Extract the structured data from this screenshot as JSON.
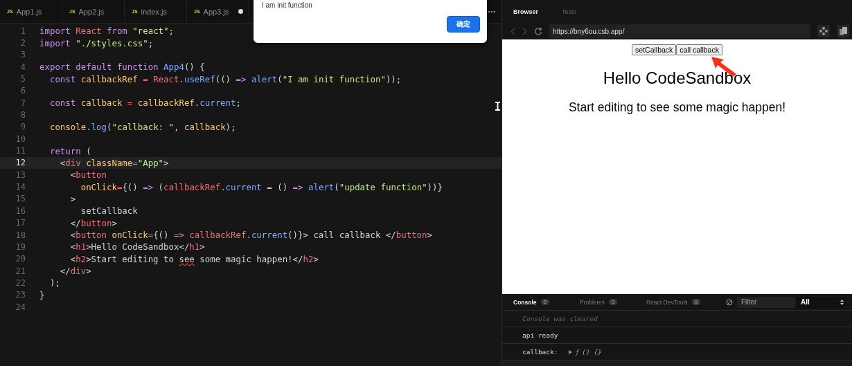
{
  "editor": {
    "tabs": [
      {
        "label": "App1.js",
        "badge": "JS",
        "modified": false,
        "selected": false
      },
      {
        "label": "App2.js",
        "badge": "JS",
        "modified": false,
        "selected": false
      },
      {
        "label": "index.js",
        "badge": "JS",
        "modified": false,
        "selected": false
      },
      {
        "label": "App3.js",
        "badge": "JS",
        "modified": true,
        "selected": false
      }
    ],
    "more": "•••",
    "lines": [
      {
        "number": "1",
        "current": false,
        "tokens": [
          {
            "kind": "kw",
            "text": "import "
          },
          {
            "kind": "name",
            "text": "React "
          },
          {
            "kind": "kw",
            "text": "from "
          },
          {
            "kind": "str",
            "text": "\"react\""
          },
          {
            "kind": "p",
            "text": ";"
          }
        ]
      },
      {
        "number": "2",
        "current": false,
        "tokens": [
          {
            "kind": "kw",
            "text": "import "
          },
          {
            "kind": "str",
            "text": "\"./styles.css\""
          },
          {
            "kind": "p",
            "text": ";"
          }
        ]
      },
      {
        "number": "3",
        "current": false
      },
      {
        "number": "4",
        "current": false,
        "tokens": [
          {
            "kind": "kw",
            "text": "export default function "
          },
          {
            "kind": "fn",
            "text": "App4"
          },
          {
            "kind": "p",
            "text": "() {"
          }
        ]
      },
      {
        "number": "5",
        "current": false,
        "tokens": [
          {
            "kind": "kw",
            "text": "  const "
          },
          {
            "kind": "var",
            "text": "callbackRef "
          },
          {
            "kind": "op",
            "text": "= "
          },
          {
            "kind": "name",
            "text": "React"
          },
          {
            "kind": "p",
            "text": "."
          },
          {
            "kind": "fn",
            "text": "useRef"
          },
          {
            "kind": "p",
            "text": "(() "
          },
          {
            "kind": "kw",
            "text": "=> "
          },
          {
            "kind": "fn",
            "text": "alert"
          },
          {
            "kind": "p",
            "text": "("
          },
          {
            "kind": "str",
            "text": "\"I am init function\""
          },
          {
            "kind": "p",
            "text": "));"
          }
        ]
      },
      {
        "number": "6",
        "current": false
      },
      {
        "number": "7",
        "current": false,
        "tokens": [
          {
            "kind": "kw",
            "text": "  const "
          },
          {
            "kind": "var",
            "text": "callback "
          },
          {
            "kind": "op",
            "text": "= "
          },
          {
            "kind": "var",
            "text": "callbackRef"
          },
          {
            "kind": "p",
            "text": "."
          },
          {
            "kind": "fn",
            "text": "current"
          },
          {
            "kind": "p",
            "text": ";"
          }
        ]
      },
      {
        "number": "8",
        "current": false
      },
      {
        "number": "9",
        "current": false,
        "tokens": [
          {
            "kind": "var",
            "text": "  console"
          },
          {
            "kind": "p",
            "text": "."
          },
          {
            "kind": "fn",
            "text": "log"
          },
          {
            "kind": "p",
            "text": "("
          },
          {
            "kind": "str",
            "text": "\"callback: \""
          },
          {
            "kind": "p",
            "text": ", "
          },
          {
            "kind": "var",
            "text": "callback"
          },
          {
            "kind": "p",
            "text": ");"
          }
        ]
      },
      {
        "number": "10",
        "current": false
      },
      {
        "number": "11",
        "current": false,
        "tokens": [
          {
            "kind": "kw",
            "text": "  return "
          },
          {
            "kind": "p",
            "text": "("
          }
        ]
      },
      {
        "number": "12",
        "current": true,
        "tokens": [
          {
            "kind": "p",
            "text": "    <"
          },
          {
            "kind": "tag",
            "text": "div "
          },
          {
            "kind": "attr",
            "text": "className"
          },
          {
            "kind": "op",
            "text": "="
          },
          {
            "kind": "str",
            "text": "\"App\""
          },
          {
            "kind": "p",
            "text": ">"
          }
        ]
      },
      {
        "number": "13",
        "current": false,
        "tokens": [
          {
            "kind": "p",
            "text": "      <"
          },
          {
            "kind": "tag",
            "text": "button"
          }
        ]
      },
      {
        "number": "14",
        "current": false,
        "tokens": [
          {
            "kind": "attr",
            "text": "        onClick"
          },
          {
            "kind": "op",
            "text": "="
          },
          {
            "kind": "p",
            "text": "{() "
          },
          {
            "kind": "kw",
            "text": "=> "
          },
          {
            "kind": "p",
            "text": "("
          },
          {
            "kind": "name",
            "text": "callbackRef"
          },
          {
            "kind": "p",
            "text": "."
          },
          {
            "kind": "fn",
            "text": "current "
          },
          {
            "kind": "p",
            "text": "= () "
          },
          {
            "kind": "kw",
            "text": "=> "
          },
          {
            "kind": "fn",
            "text": "alert"
          },
          {
            "kind": "p",
            "text": "("
          },
          {
            "kind": "str",
            "text": "\"update function\""
          },
          {
            "kind": "p",
            "text": "))}"
          }
        ]
      },
      {
        "number": "15",
        "current": false,
        "tokens": [
          {
            "kind": "p",
            "text": "      >"
          }
        ]
      },
      {
        "number": "16",
        "current": false,
        "tokens": [
          {
            "kind": "p",
            "text": "        setCallback"
          }
        ]
      },
      {
        "number": "17",
        "current": false,
        "tokens": [
          {
            "kind": "p",
            "text": "      </"
          },
          {
            "kind": "tag",
            "text": "button"
          },
          {
            "kind": "p",
            "text": ">"
          }
        ]
      },
      {
        "number": "18",
        "current": false,
        "tokens": [
          {
            "kind": "p",
            "text": "      <"
          },
          {
            "kind": "tag",
            "text": "button "
          },
          {
            "kind": "attr",
            "text": "onClick"
          },
          {
            "kind": "op",
            "text": "="
          },
          {
            "kind": "p",
            "text": "{() "
          },
          {
            "kind": "kw",
            "text": "=> "
          },
          {
            "kind": "name",
            "text": "callbackRef"
          },
          {
            "kind": "p",
            "text": "."
          },
          {
            "kind": "fn",
            "text": "current"
          },
          {
            "kind": "p",
            "text": "()}> call callback </"
          },
          {
            "kind": "tag",
            "text": "button"
          },
          {
            "kind": "p",
            "text": ">"
          }
        ]
      },
      {
        "number": "19",
        "current": false,
        "tokens": [
          {
            "kind": "p",
            "text": "      <"
          },
          {
            "kind": "tag",
            "text": "h1"
          },
          {
            "kind": "p",
            "text": ">Hello CodeSandbox</"
          },
          {
            "kind": "tag",
            "text": "h1"
          },
          {
            "kind": "p",
            "text": ">"
          }
        ]
      },
      {
        "number": "20",
        "current": false,
        "tokens": [
          {
            "kind": "p",
            "text": "      <"
          },
          {
            "kind": "tag",
            "text": "h2"
          },
          {
            "kind": "p",
            "text": ">Start editing to "
          },
          {
            "kind": "typo",
            "text": "see"
          },
          {
            "kind": "p",
            "text": " some magic happen!</"
          },
          {
            "kind": "tag",
            "text": "h2"
          },
          {
            "kind": "p",
            "text": ">"
          }
        ]
      },
      {
        "number": "21",
        "current": false,
        "tokens": [
          {
            "kind": "p",
            "text": "    </"
          },
          {
            "kind": "tag",
            "text": "div"
          },
          {
            "kind": "p",
            "text": ">"
          }
        ]
      },
      {
        "number": "22",
        "current": false,
        "tokens": [
          {
            "kind": "p",
            "text": "  );"
          }
        ]
      },
      {
        "number": "23",
        "current": false,
        "tokens": [
          {
            "kind": "p",
            "text": "}"
          }
        ]
      },
      {
        "number": "24",
        "current": false
      }
    ]
  },
  "alert": {
    "message": "I am init function",
    "button": "确定"
  },
  "browser": {
    "tabs": [
      {
        "label": "Browser",
        "selected": true
      },
      {
        "label": "Tests",
        "selected": false
      }
    ],
    "url": "https://bny6ou.csb.app/",
    "preview": {
      "buttons": [
        "setCallback",
        "call callback"
      ],
      "heading": "Hello CodeSandbox",
      "subheading": "Start editing to see some magic happen!"
    }
  },
  "console": {
    "tabs": [
      {
        "label": "Console",
        "count": "0",
        "selected": true
      },
      {
        "label": "Problems",
        "count": "0",
        "selected": false
      },
      {
        "label": "React DevTools",
        "count": "0",
        "selected": false
      }
    ],
    "filter": {
      "placeholder": "Filter"
    },
    "level": "All",
    "entries": [
      {
        "kind": "info",
        "text": "Console was cleared"
      },
      {
        "kind": "log",
        "text": "api ready"
      },
      {
        "kind": "function",
        "text": "callback:",
        "fn": "ƒ",
        "signature": "() {}"
      }
    ]
  }
}
